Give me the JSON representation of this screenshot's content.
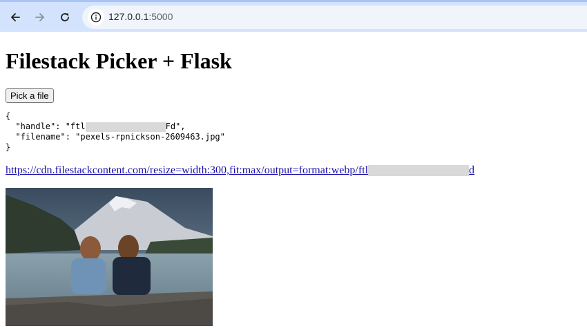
{
  "browser": {
    "url_host": "127.0.0.1",
    "url_port": ":5000"
  },
  "page": {
    "title": "Filestack Picker + Flask",
    "pick_button": "Pick a file",
    "json_open": "{",
    "handle_key": "  \"handle\": \"ftl",
    "handle_suffix": "Fd\",",
    "filename_line": "  \"filename\": \"pexels-rpnickson-2609463.jpg\"",
    "json_close": "}",
    "link_prefix": "https://cdn.filestackcontent.com/resize=width:300,fit:max/output=format:webp/ftl",
    "link_suffix": "d"
  },
  "icons": [
    "back-arrow-icon",
    "forward-arrow-icon",
    "reload-icon",
    "info-icon"
  ]
}
